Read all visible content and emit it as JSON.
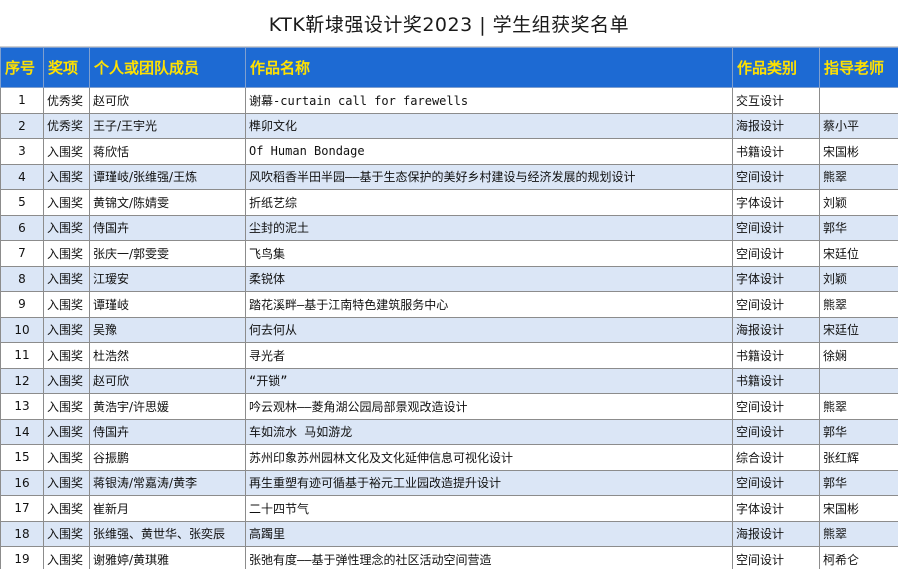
{
  "title": "KTK靳埭强设计奖2023 | 学生组获奖名单",
  "columns": [
    "序号",
    "奖项",
    "个人或团队成员",
    "作品名称",
    "作品类别",
    "指导老师"
  ],
  "rows": [
    {
      "no": "1",
      "award": "优秀奖",
      "members": "赵可欣",
      "work": "谢幕-curtain call for farewells",
      "category": "交互设计",
      "advisor": ""
    },
    {
      "no": "2",
      "award": "优秀奖",
      "members": "王子/王宇光",
      "work": "榫卯文化",
      "category": "海报设计",
      "advisor": "蔡小平"
    },
    {
      "no": "3",
      "award": "入围奖",
      "members": "蒋欣恬",
      "work": "Of Human Bondage",
      "category": "书籍设计",
      "advisor": "宋国彬"
    },
    {
      "no": "4",
      "award": "入围奖",
      "members": "谭瑾岐/张维强/王炼",
      "work": "风吹稻香半田半园——基于生态保护的美好乡村建设与经济发展的规划设计",
      "category": "空间设计",
      "advisor": "熊翠"
    },
    {
      "no": "5",
      "award": "入围奖",
      "members": "黄锦文/陈婧雯",
      "work": "折纸艺综",
      "category": "字体设计",
      "advisor": "刘颖"
    },
    {
      "no": "6",
      "award": "入围奖",
      "members": "侍国卉",
      "work": "尘封的泥土",
      "category": "空间设计",
      "advisor": "郭华"
    },
    {
      "no": "7",
      "award": "入围奖",
      "members": "张庆一/郭雯雯",
      "work": "飞鸟集",
      "category": "空间设计",
      "advisor": "宋廷位"
    },
    {
      "no": "8",
      "award": "入围奖",
      "members": "江瑷安",
      "work": "柔锐体",
      "category": "字体设计",
      "advisor": "刘颖"
    },
    {
      "no": "9",
      "award": "入围奖",
      "members": "谭瑾岐",
      "work": "踏花溪畔—基于江南特色建筑服务中心",
      "category": "空间设计",
      "advisor": "熊翠"
    },
    {
      "no": "10",
      "award": "入围奖",
      "members": "吴豫",
      "work": "何去何从",
      "category": "海报设计",
      "advisor": "宋廷位"
    },
    {
      "no": "11",
      "award": "入围奖",
      "members": "杜浩然",
      "work": "寻光者",
      "category": "书籍设计",
      "advisor": "徐娴"
    },
    {
      "no": "12",
      "award": "入围奖",
      "members": "赵可欣",
      "work": "“开锁”",
      "category": "书籍设计",
      "advisor": ""
    },
    {
      "no": "13",
      "award": "入围奖",
      "members": "黄浩宇/许思媛",
      "work": "吟云观林——菱角湖公园局部景观改造设计",
      "category": "空间设计",
      "advisor": "熊翠"
    },
    {
      "no": "14",
      "award": "入围奖",
      "members": "侍国卉",
      "work": "车如流水 马如游龙",
      "category": "空间设计",
      "advisor": "郭华"
    },
    {
      "no": "15",
      "award": "入围奖",
      "members": "谷振鹏",
      "work": "苏州印象苏州园林文化及文化延伸信息可视化设计",
      "category": "综合设计",
      "advisor": "张红辉"
    },
    {
      "no": "16",
      "award": "入围奖",
      "members": "蒋银涛/常嘉涛/黄李",
      "work": "再生重塑有迹可循基于裕元工业园改造提升设计",
      "category": "空间设计",
      "advisor": "郭华"
    },
    {
      "no": "17",
      "award": "入围奖",
      "members": "崔新月",
      "work": "二十四节气",
      "category": "字体设计",
      "advisor": "宋国彬"
    },
    {
      "no": "18",
      "award": "入围奖",
      "members": "张维强、黄世华、张奕辰",
      "work": "高躅里",
      "category": "海报设计",
      "advisor": "熊翠"
    },
    {
      "no": "19",
      "award": "入围奖",
      "members": "谢雅婷/黄琪雅",
      "work": "张弛有度——基于弹性理念的社区活动空间营造",
      "category": "空间设计",
      "advisor": "柯希仑"
    }
  ]
}
